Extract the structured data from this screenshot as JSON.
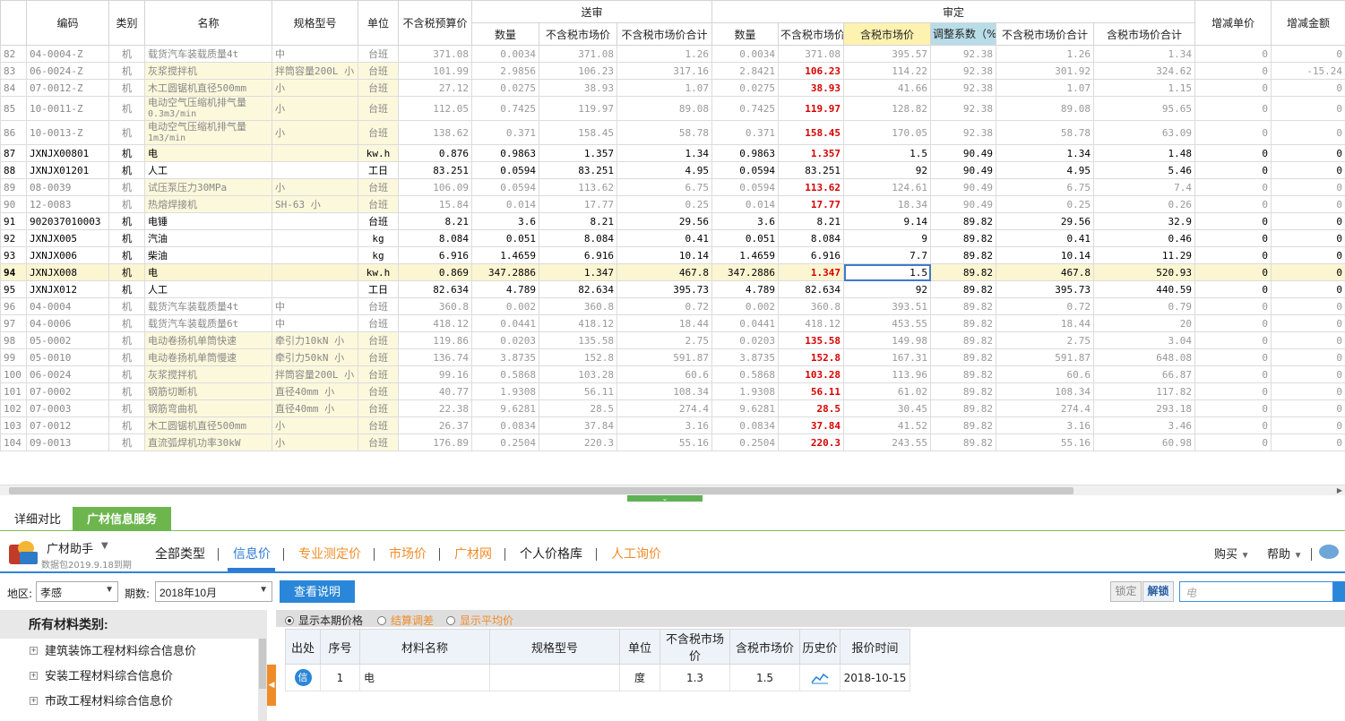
{
  "grid": {
    "group_headers": {
      "submitted": "送审",
      "approved": "审定"
    },
    "columns": {
      "code": "编码",
      "category": "类别",
      "name": "名称",
      "spec": "规格型号",
      "unit": "单位",
      "budget_price": "不含税预算价",
      "sub_qty": "数量",
      "sub_market_price": "不含税市场价",
      "sub_market_total": "不含税市场价合计",
      "app_qty": "数量",
      "app_market_price": "不含税市场价",
      "app_tax_market_price": "含税市场价",
      "adjust_coef": "调整系数（%）",
      "app_market_total": "不含税市场价合计",
      "app_tax_market_total": "含税市场价合计",
      "diff_unit": "增减单价",
      "diff_amount": "增减金额"
    },
    "rows": [
      {
        "n": "82",
        "code": "04-0004-Z",
        "cat": "机",
        "name": "载货汽车装载质量4t",
        "name2": "",
        "spec": "中",
        "unit": "台班",
        "budget": "371.08",
        "sq": "0.0034",
        "sp": "371.08",
        "st": "1.26",
        "aq": "0.0034",
        "ap": "371.08",
        "atp": "395.57",
        "coef": "92.38",
        "at": "1.26",
        "att": "1.34",
        "du": "0",
        "da": "0",
        "style": "gray",
        "tall": false
      },
      {
        "n": "83",
        "code": "06-0024-Z",
        "cat": "机",
        "name": "灰浆搅拌机",
        "name2": "",
        "spec": "拌筒容量200L 小",
        "unit": "台班",
        "budget": "101.99",
        "sq": "2.9856",
        "sp": "106.23",
        "st": "317.16",
        "aq": "2.8421",
        "ap": "106.23",
        "atp": "114.22",
        "coef": "92.38",
        "at": "301.92",
        "att": "324.62",
        "du": "0",
        "da": "-15.24",
        "style": "gray yel",
        "tall": false,
        "red": true
      },
      {
        "n": "84",
        "code": "07-0012-Z",
        "cat": "机",
        "name": "木工圆锯机直径500mm",
        "name2": "",
        "spec": "小",
        "unit": "台班",
        "budget": "27.12",
        "sq": "0.0275",
        "sp": "38.93",
        "st": "1.07",
        "aq": "0.0275",
        "ap": "38.93",
        "atp": "41.66",
        "coef": "92.38",
        "at": "1.07",
        "att": "1.15",
        "du": "0",
        "da": "0",
        "style": "gray yel",
        "tall": false,
        "red": true
      },
      {
        "n": "85",
        "code": "10-0011-Z",
        "cat": "机",
        "name": "电动空气压缩机排气量",
        "name2": "0.3m3/min",
        "spec": "小",
        "unit": "台班",
        "budget": "112.05",
        "sq": "0.7425",
        "sp": "119.97",
        "st": "89.08",
        "aq": "0.7425",
        "ap": "119.97",
        "atp": "128.82",
        "coef": "92.38",
        "at": "89.08",
        "att": "95.65",
        "du": "0",
        "da": "0",
        "style": "gray yel",
        "tall": true,
        "red": true
      },
      {
        "n": "86",
        "code": "10-0013-Z",
        "cat": "机",
        "name": "电动空气压缩机排气量",
        "name2": "1m3/min",
        "spec": "小",
        "unit": "台班",
        "budget": "138.62",
        "sq": "0.371",
        "sp": "158.45",
        "st": "58.78",
        "aq": "0.371",
        "ap": "158.45",
        "atp": "170.05",
        "coef": "92.38",
        "at": "58.78",
        "att": "63.09",
        "du": "0",
        "da": "0",
        "style": "gray yel",
        "tall": true,
        "red": true
      },
      {
        "n": "87",
        "code": "JXNJX00801",
        "cat": "机",
        "name": "电",
        "name2": "",
        "spec": "",
        "unit": "kw.h",
        "budget": "0.876",
        "sq": "0.9863",
        "sp": "1.357",
        "st": "1.34",
        "aq": "0.9863",
        "ap": "1.357",
        "atp": "1.5",
        "coef": "90.49",
        "at": "1.34",
        "att": "1.48",
        "du": "0",
        "da": "0",
        "style": "bold yel",
        "tall": false,
        "red": true
      },
      {
        "n": "88",
        "code": "JXNJX01201",
        "cat": "机",
        "name": "人工",
        "name2": "",
        "spec": "",
        "unit": "工日",
        "budget": "83.251",
        "sq": "0.0594",
        "sp": "83.251",
        "st": "4.95",
        "aq": "0.0594",
        "ap": "83.251",
        "atp": "92",
        "coef": "90.49",
        "at": "4.95",
        "att": "5.46",
        "du": "0",
        "da": "0",
        "style": "bold",
        "tall": false
      },
      {
        "n": "89",
        "code": "08-0039",
        "cat": "机",
        "name": "试压泵压力30MPa",
        "name2": "",
        "spec": "小",
        "unit": "台班",
        "budget": "106.09",
        "sq": "0.0594",
        "sp": "113.62",
        "st": "6.75",
        "aq": "0.0594",
        "ap": "113.62",
        "atp": "124.61",
        "coef": "90.49",
        "at": "6.75",
        "att": "7.4",
        "du": "0",
        "da": "0",
        "style": "gray yel",
        "tall": false,
        "red": true
      },
      {
        "n": "90",
        "code": "12-0083",
        "cat": "机",
        "name": "热熔焊接机",
        "name2": "",
        "spec": "SH-63 小",
        "unit": "台班",
        "budget": "15.84",
        "sq": "0.014",
        "sp": "17.77",
        "st": "0.25",
        "aq": "0.014",
        "ap": "17.77",
        "atp": "18.34",
        "coef": "90.49",
        "at": "0.25",
        "att": "0.26",
        "du": "0",
        "da": "0",
        "style": "gray yel",
        "tall": false,
        "red": true
      },
      {
        "n": "91",
        "code": "902037010003",
        "cat": "机",
        "name": "电锤",
        "name2": "",
        "spec": "",
        "unit": "台班",
        "budget": "8.21",
        "sq": "3.6",
        "sp": "8.21",
        "st": "29.56",
        "aq": "3.6",
        "ap": "8.21",
        "atp": "9.14",
        "coef": "89.82",
        "at": "29.56",
        "att": "32.9",
        "du": "0",
        "da": "0",
        "style": "bold",
        "tall": true
      },
      {
        "n": "92",
        "code": "JXNJX005",
        "cat": "机",
        "name": "汽油",
        "name2": "",
        "spec": "",
        "unit": "kg",
        "budget": "8.084",
        "sq": "0.051",
        "sp": "8.084",
        "st": "0.41",
        "aq": "0.051",
        "ap": "8.084",
        "atp": "9",
        "coef": "89.82",
        "at": "0.41",
        "att": "0.46",
        "du": "0",
        "da": "0",
        "style": "bold",
        "tall": false
      },
      {
        "n": "93",
        "code": "JXNJX006",
        "cat": "机",
        "name": "柴油",
        "name2": "",
        "spec": "",
        "unit": "kg",
        "budget": "6.916",
        "sq": "1.4659",
        "sp": "6.916",
        "st": "10.14",
        "aq": "1.4659",
        "ap": "6.916",
        "atp": "7.7",
        "coef": "89.82",
        "at": "10.14",
        "att": "11.29",
        "du": "0",
        "da": "0",
        "style": "bold",
        "tall": false
      },
      {
        "n": "94",
        "code": "JXNJX008",
        "cat": "机",
        "name": "电",
        "name2": "",
        "spec": "",
        "unit": "kw.h",
        "budget": "0.869",
        "sq": "347.2886",
        "sp": "1.347",
        "st": "467.8",
        "aq": "347.2886",
        "ap": "1.347",
        "atp": "1.5",
        "coef": "89.82",
        "at": "467.8",
        "att": "520.93",
        "du": "0",
        "da": "0",
        "style": "bold cur",
        "tall": false,
        "red": true,
        "sel": true
      },
      {
        "n": "95",
        "code": "JXNJX012",
        "cat": "机",
        "name": "人工",
        "name2": "",
        "spec": "",
        "unit": "工日",
        "budget": "82.634",
        "sq": "4.789",
        "sp": "82.634",
        "st": "395.73",
        "aq": "4.789",
        "ap": "82.634",
        "atp": "92",
        "coef": "89.82",
        "at": "395.73",
        "att": "440.59",
        "du": "0",
        "da": "0",
        "style": "bold",
        "tall": false
      },
      {
        "n": "96",
        "code": "04-0004",
        "cat": "机",
        "name": "载货汽车装载质量4t",
        "name2": "",
        "spec": "中",
        "unit": "台班",
        "budget": "360.8",
        "sq": "0.002",
        "sp": "360.8",
        "st": "0.72",
        "aq": "0.002",
        "ap": "360.8",
        "atp": "393.51",
        "coef": "89.82",
        "at": "0.72",
        "att": "0.79",
        "du": "0",
        "da": "0",
        "style": "gray",
        "tall": false
      },
      {
        "n": "97",
        "code": "04-0006",
        "cat": "机",
        "name": "载货汽车装载质量6t",
        "name2": "",
        "spec": "中",
        "unit": "台班",
        "budget": "418.12",
        "sq": "0.0441",
        "sp": "418.12",
        "st": "18.44",
        "aq": "0.0441",
        "ap": "418.12",
        "atp": "453.55",
        "coef": "89.82",
        "at": "18.44",
        "att": "20",
        "du": "0",
        "da": "0",
        "style": "gray",
        "tall": false
      },
      {
        "n": "98",
        "code": "05-0002",
        "cat": "机",
        "name": "电动卷扬机单筒快速",
        "name2": "",
        "spec": "牵引力10kN 小",
        "unit": "台班",
        "budget": "119.86",
        "sq": "0.0203",
        "sp": "135.58",
        "st": "2.75",
        "aq": "0.0203",
        "ap": "135.58",
        "atp": "149.98",
        "coef": "89.82",
        "at": "2.75",
        "att": "3.04",
        "du": "0",
        "da": "0",
        "style": "gray yel",
        "tall": false,
        "red": true
      },
      {
        "n": "99",
        "code": "05-0010",
        "cat": "机",
        "name": "电动卷扬机单筒慢速",
        "name2": "",
        "spec": "牵引力50kN 小",
        "unit": "台班",
        "budget": "136.74",
        "sq": "3.8735",
        "sp": "152.8",
        "st": "591.87",
        "aq": "3.8735",
        "ap": "152.8",
        "atp": "167.31",
        "coef": "89.82",
        "at": "591.87",
        "att": "648.08",
        "du": "0",
        "da": "0",
        "style": "gray yel",
        "tall": false,
        "red": true
      },
      {
        "n": "100",
        "code": "06-0024",
        "cat": "机",
        "name": "灰浆搅拌机",
        "name2": "",
        "spec": "拌筒容量200L 小",
        "unit": "台班",
        "budget": "99.16",
        "sq": "0.5868",
        "sp": "103.28",
        "st": "60.6",
        "aq": "0.5868",
        "ap": "103.28",
        "atp": "113.96",
        "coef": "89.82",
        "at": "60.6",
        "att": "66.87",
        "du": "0",
        "da": "0",
        "style": "gray yel",
        "tall": false,
        "red": true
      },
      {
        "n": "101",
        "code": "07-0002",
        "cat": "机",
        "name": "钢筋切断机",
        "name2": "",
        "spec": "直径40mm 小",
        "unit": "台班",
        "budget": "40.77",
        "sq": "1.9308",
        "sp": "56.11",
        "st": "108.34",
        "aq": "1.9308",
        "ap": "56.11",
        "atp": "61.02",
        "coef": "89.82",
        "at": "108.34",
        "att": "117.82",
        "du": "0",
        "da": "0",
        "style": "gray yel",
        "tall": false,
        "red": true
      },
      {
        "n": "102",
        "code": "07-0003",
        "cat": "机",
        "name": "钢筋弯曲机",
        "name2": "",
        "spec": "直径40mm 小",
        "unit": "台班",
        "budget": "22.38",
        "sq": "9.6281",
        "sp": "28.5",
        "st": "274.4",
        "aq": "9.6281",
        "ap": "28.5",
        "atp": "30.45",
        "coef": "89.82",
        "at": "274.4",
        "att": "293.18",
        "du": "0",
        "da": "0",
        "style": "gray yel",
        "tall": false,
        "red": true
      },
      {
        "n": "103",
        "code": "07-0012",
        "cat": "机",
        "name": "木工圆锯机直径500mm",
        "name2": "",
        "spec": "小",
        "unit": "台班",
        "budget": "26.37",
        "sq": "0.0834",
        "sp": "37.84",
        "st": "3.16",
        "aq": "0.0834",
        "ap": "37.84",
        "atp": "41.52",
        "coef": "89.82",
        "at": "3.16",
        "att": "3.46",
        "du": "0",
        "da": "0",
        "style": "gray yel",
        "tall": false,
        "red": true
      },
      {
        "n": "104",
        "code": "09-0013",
        "cat": "机",
        "name": "直流弧焊机功率30kW",
        "name2": "",
        "spec": "小",
        "unit": "台班",
        "budget": "176.89",
        "sq": "0.2504",
        "sp": "220.3",
        "st": "55.16",
        "aq": "0.2504",
        "ap": "220.3",
        "atp": "243.55",
        "coef": "89.82",
        "at": "55.16",
        "att": "60.98",
        "du": "0",
        "da": "0",
        "style": "gray yel",
        "tall": false,
        "red": true
      }
    ]
  },
  "tabs": {
    "detail": "详细对比",
    "info_service": "广材信息服务"
  },
  "toolbar": {
    "brand": "广材助手",
    "brand_sub": "数据包2019.9.18到期",
    "nav": [
      "全部类型",
      "信息价",
      "专业测定价",
      "市场价",
      "广材网",
      "个人价格库",
      "人工询价"
    ],
    "buy": "购买",
    "help": "帮助"
  },
  "filter": {
    "region_label": "地区:",
    "region_value": "孝感",
    "period_label": "期数:",
    "period_value": "2018年10月",
    "view_button": "查看说明",
    "lock": "锁定",
    "unlock": "解锁",
    "search_value": "电"
  },
  "left_panel": {
    "title": "所有材料类别:",
    "items": [
      "建筑装饰工程材料综合信息价",
      "安装工程材料综合信息价",
      "市政工程材料综合信息价"
    ]
  },
  "price_panel": {
    "radios": [
      "显示本期价格",
      "结算调差",
      "显示平均价"
    ],
    "columns": [
      "出处",
      "序号",
      "材料名称",
      "规格型号",
      "单位",
      "不含税市场价",
      "含税市场价",
      "历史价",
      "报价时间"
    ],
    "rows": [
      {
        "source": "信",
        "seq": "1",
        "name": "电",
        "spec": "",
        "unit": "度",
        "price": "1.3",
        "tax_price": "1.5",
        "date": "2018-10-15"
      }
    ]
  }
}
